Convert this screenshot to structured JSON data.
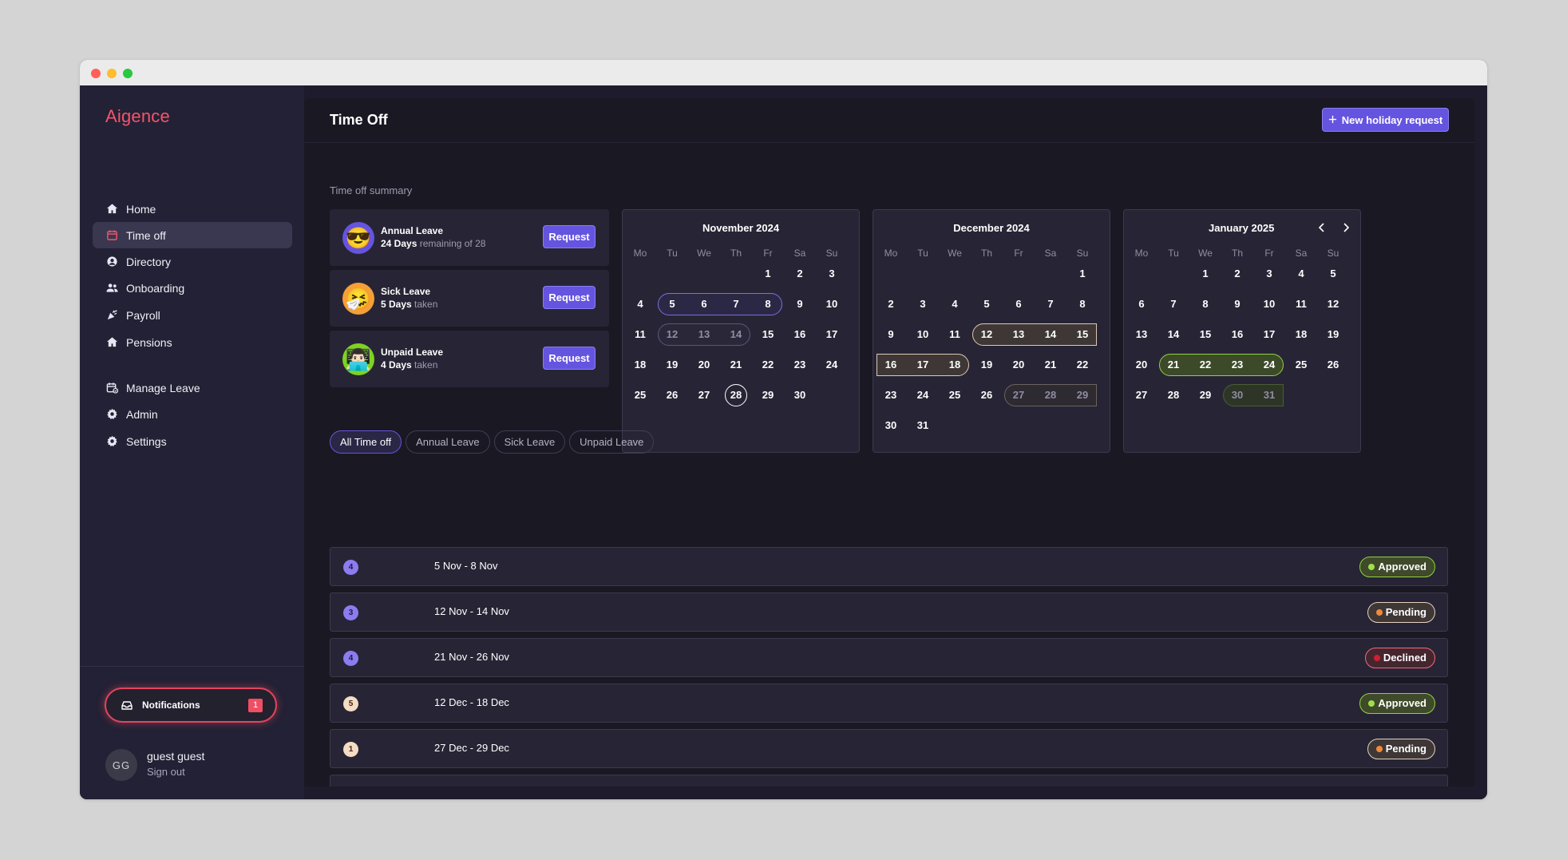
{
  "app": {
    "logo": "Aigence"
  },
  "sidebar": {
    "items": [
      {
        "label": "Home",
        "icon": "home-icon",
        "active": false
      },
      {
        "label": "Time off",
        "icon": "calendar-icon",
        "active": true
      },
      {
        "label": "Directory",
        "icon": "user-circle-icon",
        "active": false
      },
      {
        "label": "Onboarding",
        "icon": "users-icon",
        "active": false
      },
      {
        "label": "Payroll",
        "icon": "party-popper-icon",
        "active": false
      },
      {
        "label": "Pensions",
        "icon": "home-icon",
        "active": false
      },
      {
        "label": "Manage Leave",
        "icon": "calendar-check-icon",
        "active": false
      },
      {
        "label": "Admin",
        "icon": "gear-icon",
        "active": false
      },
      {
        "label": "Settings",
        "icon": "gear-icon",
        "active": false
      }
    ],
    "notifications": {
      "label": "Notifications",
      "count": "1"
    },
    "user": {
      "initials": "GG",
      "name": "guest guest",
      "signout": "Sign out"
    }
  },
  "header": {
    "title": "Time Off",
    "new_request_label": "New holiday request"
  },
  "summary": {
    "label": "Time off summary",
    "cards": [
      {
        "name": "Annual Leave",
        "bold": "24 Days",
        "rest": "remaining of 28",
        "emoji": "😎",
        "emoji_bg": "#6554e0",
        "button": "Request"
      },
      {
        "name": "Sick Leave",
        "bold": "5 Days",
        "rest": "taken",
        "emoji": "🤧",
        "emoji_bg": "#f59f36",
        "button": "Request"
      },
      {
        "name": "Unpaid Leave",
        "bold": "4 Days",
        "rest": "taken",
        "emoji": "👨🏻‍💻",
        "emoji_bg": "#7ed321",
        "button": "Request"
      }
    ]
  },
  "calendar": {
    "weekdays": [
      "Mo",
      "Tu",
      "We",
      "Th",
      "Fr",
      "Sa",
      "Su"
    ],
    "months": [
      {
        "title": "November 2024",
        "first_weekday": 4,
        "days": 30,
        "today": 28,
        "ranges": [
          {
            "start": 5,
            "end": 8,
            "color": "purple",
            "muted": false
          },
          {
            "start": 12,
            "end": 14,
            "color": "purple",
            "muted": true
          }
        ]
      },
      {
        "title": "December 2024",
        "first_weekday": 6,
        "days": 31,
        "today": null,
        "ranges": [
          {
            "start": 12,
            "end": 15,
            "color": "tan",
            "muted": false
          },
          {
            "start": 16,
            "end": 18,
            "color": "tan",
            "muted": false
          },
          {
            "start": 27,
            "end": 29,
            "color": "tan",
            "muted": true
          }
        ]
      },
      {
        "title": "January 2025",
        "first_weekday": 2,
        "days": 31,
        "today": null,
        "nav": true,
        "ranges": [
          {
            "start": 21,
            "end": 24,
            "color": "green",
            "muted": false
          },
          {
            "start": 30,
            "end": 31,
            "color": "green",
            "muted": true
          }
        ]
      }
    ]
  },
  "filters": {
    "tabs": [
      "All Time off",
      "Annual Leave",
      "Sick Leave",
      "Unpaid Leave"
    ],
    "active": 0
  },
  "requests": [
    {
      "days": "4",
      "range": "5 Nov - 8 Nov",
      "status": "Approved",
      "badge_bg": "#8b7cf0",
      "badge_fg": "#1f1a3d"
    },
    {
      "days": "3",
      "range": "12 Nov - 14 Nov",
      "status": "Pending",
      "badge_bg": "#8b7cf0",
      "badge_fg": "#1f1a3d"
    },
    {
      "days": "4",
      "range": "21 Nov - 26 Nov",
      "status": "Declined",
      "badge_bg": "#8b7cf0",
      "badge_fg": "#1f1a3d"
    },
    {
      "days": "5",
      "range": "12 Dec - 18 Dec",
      "status": "Approved",
      "badge_bg": "#f5dcc4",
      "badge_fg": "#3d2a1a"
    },
    {
      "days": "1",
      "range": "27 Dec - 29 Dec",
      "status": "Pending",
      "badge_bg": "#f5dcc4",
      "badge_fg": "#3d2a1a"
    }
  ]
}
